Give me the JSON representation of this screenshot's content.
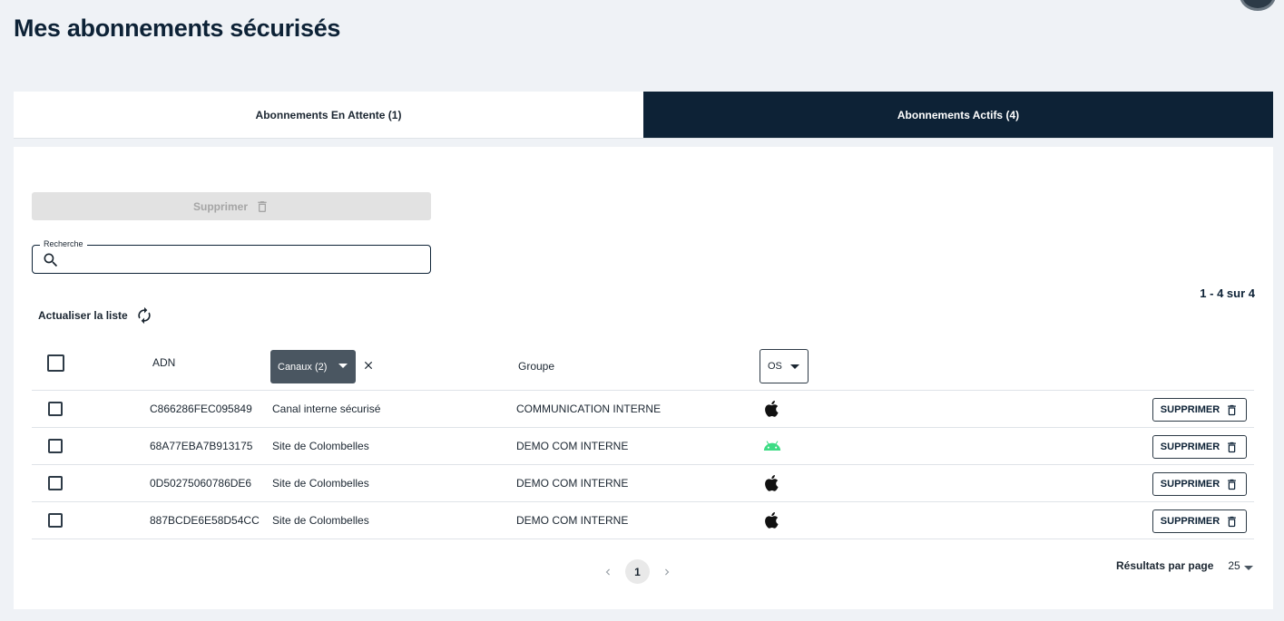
{
  "page": {
    "title": "Mes abonnements sécurisés"
  },
  "tabs": [
    {
      "label": "Abonnements En Attente (1)",
      "active": false
    },
    {
      "label": "Abonnements Actifs (4)",
      "active": true
    }
  ],
  "toolbar": {
    "delete_all_label": "Supprimer"
  },
  "search": {
    "label": "Recherche",
    "value": "",
    "placeholder": ""
  },
  "pagination": {
    "range": "1 - 4 sur 4",
    "current_page": "1",
    "per_page_label": "Résultats par page",
    "per_page_value": "25"
  },
  "refresh": {
    "label": "Actualiser la liste"
  },
  "table": {
    "headers": {
      "adn": "ADN",
      "canaux": "Canaux (2)",
      "groupe": "Groupe",
      "os": "OS"
    },
    "rows": [
      {
        "adn": "C866286FEC095849",
        "canal": "Canal interne sécurisé",
        "groupe": "COMMUNICATION INTERNE",
        "os": "apple-icon"
      },
      {
        "adn": "68A77EBA7B913175",
        "canal": "Site de Colombelles",
        "groupe": "DEMO COM INTERNE",
        "os": "android-icon"
      },
      {
        "adn": "0D50275060786DE6",
        "canal": "Site de Colombelles",
        "groupe": "DEMO COM INTERNE",
        "os": "apple-icon"
      },
      {
        "adn": "887BCDE6E58D54CC",
        "canal": "Site de Colombelles",
        "groupe": "DEMO COM INTERNE",
        "os": "apple-icon"
      }
    ],
    "row_action_label": "SUPPRIMER"
  },
  "colors": {
    "navy": "#0d2236",
    "android_green": "#3ddc84"
  }
}
